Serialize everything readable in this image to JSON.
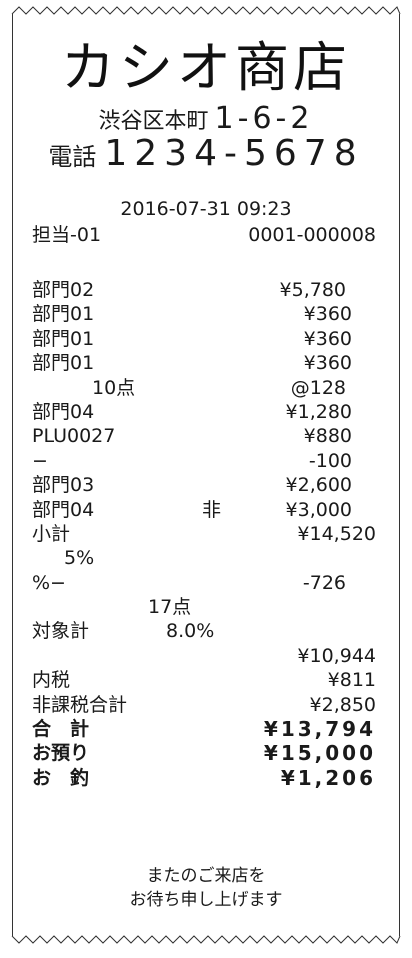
{
  "store": {
    "name": "カシオ商店",
    "address_label": "渋谷区本町",
    "address_number": "1-6-2",
    "phone_label": "電話",
    "phone_number": "1234-5678"
  },
  "transaction": {
    "datetime": "2016-07-31 09:23",
    "staff": "担当-01",
    "receipt_no": "0001-000008"
  },
  "lines": [
    {
      "label": "部門02",
      "mid": "",
      "amount": "¥5,780"
    },
    {
      "label": "部門01",
      "mid": "",
      "amount": "¥360"
    },
    {
      "label": "部門01",
      "mid": "",
      "amount": "¥360"
    },
    {
      "label": "部門01",
      "mid": "",
      "amount": "¥360"
    },
    {
      "label": "",
      "mid": "10点",
      "amount": "@128"
    },
    {
      "label": "部門04",
      "mid": "",
      "amount": "¥1,280"
    },
    {
      "label": "PLU0027",
      "mid": "",
      "amount": "¥880"
    },
    {
      "label": "−",
      "mid": "",
      "amount": "-100"
    },
    {
      "label": "部門03",
      "mid": "",
      "amount": "¥2,600"
    },
    {
      "label": "部門04",
      "mid": "非",
      "amount": "¥3,000"
    },
    {
      "label": "小計",
      "mid": "",
      "amount": "¥14,520"
    },
    {
      "label": "",
      "mid": "5%",
      "amount": ""
    },
    {
      "label": "%−",
      "mid": "",
      "amount": "-726"
    },
    {
      "label": "",
      "mid": "17点",
      "amount": ""
    },
    {
      "label": "対象計",
      "mid": "8.0%",
      "amount": ""
    },
    {
      "label": "",
      "mid": "",
      "amount": "¥10,944"
    },
    {
      "label": "内税",
      "mid": "",
      "amount": "¥811"
    },
    {
      "label": "非課税合計",
      "mid": "",
      "amount": "¥2,850"
    },
    {
      "label": "合　計",
      "mid": "",
      "amount": "¥13,794"
    },
    {
      "label": "お預り",
      "mid": "",
      "amount": "¥15,000"
    },
    {
      "label": "お　釣",
      "mid": "",
      "amount": "¥1,206"
    }
  ],
  "footer": {
    "line1": "またのご来店を",
    "line2": "お待ち申し上げます"
  }
}
